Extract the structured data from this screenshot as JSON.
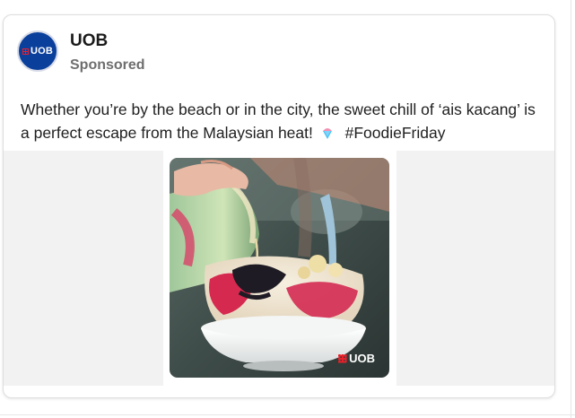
{
  "post": {
    "author": {
      "name": "UOB",
      "subtitle": "Sponsored",
      "avatar_text": "UOB"
    },
    "text": {
      "body": "Whether you’re by the beach or in the city, the sweet chill of ‘ais kacang’ is a perfect escape from the Malaysian heat!",
      "emoji_icon": "shaved-ice-icon",
      "hashtag": "#FoodieFriday"
    },
    "media": {
      "watermark_text": "UOB",
      "description_icon": "ais-kacang-photo"
    }
  },
  "colors": {
    "brand_blue": "#0a3f9c",
    "brand_red": "#e8202a",
    "text_primary": "#1f1f1f",
    "text_secondary": "#6e6e6e"
  }
}
